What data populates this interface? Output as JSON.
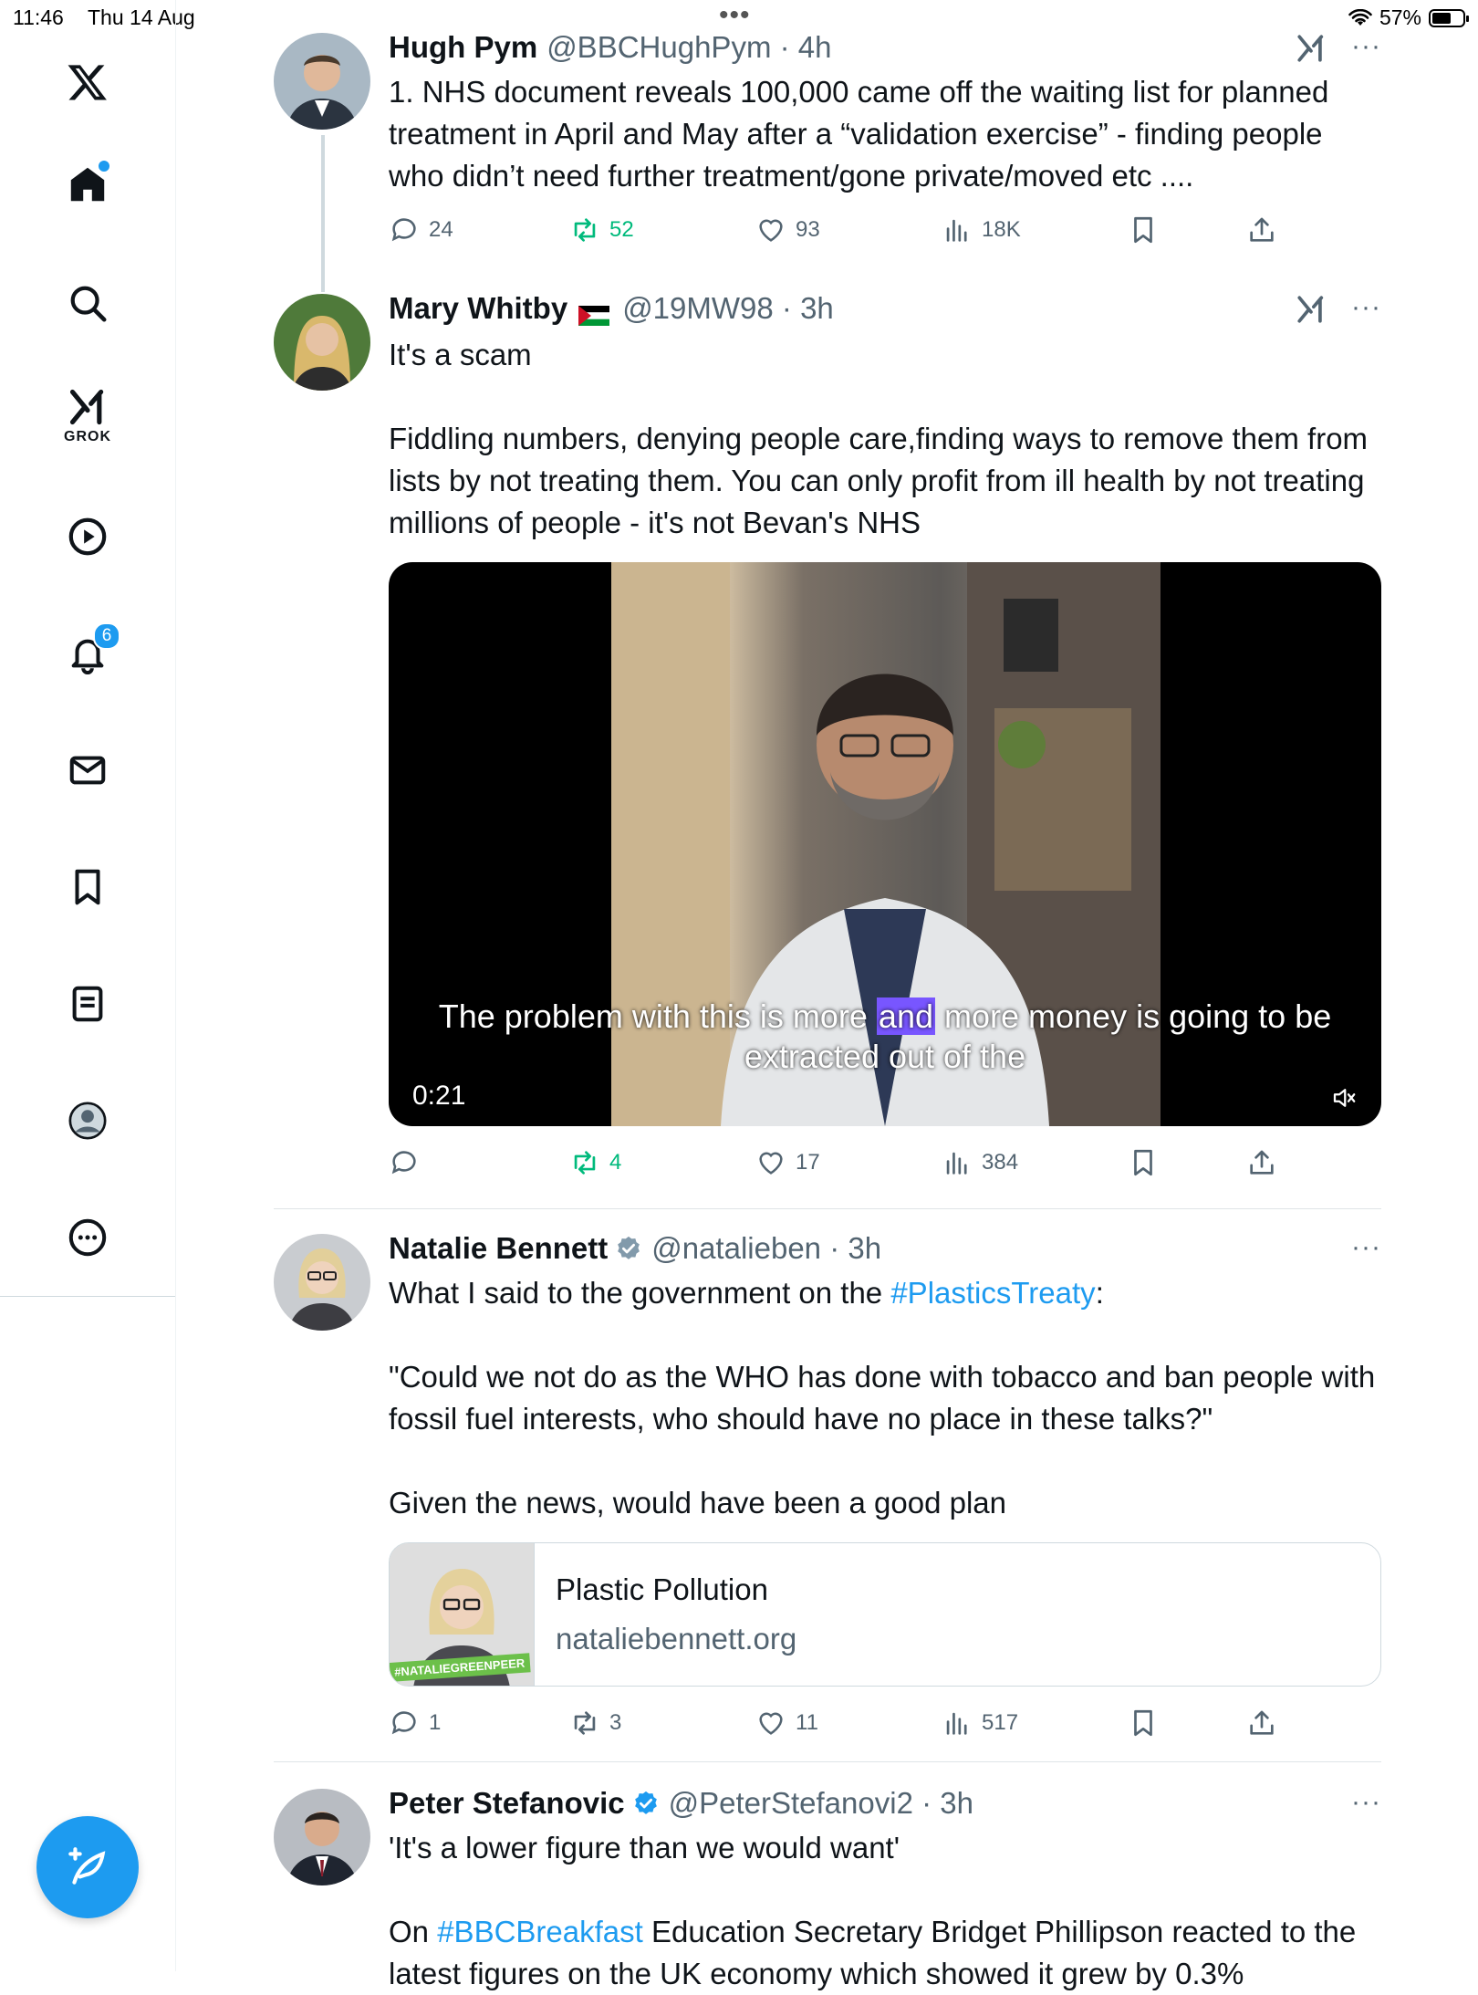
{
  "status_bar": {
    "time": "11:46",
    "date": "Thu 14 Aug",
    "battery": "57%"
  },
  "sidebar": {
    "grok_label": "GROK",
    "notifications_count": "6"
  },
  "colors": {
    "accent": "#1d9bf0",
    "retweet": "#00ba7c",
    "muted": "#536471",
    "caption_highlight": "#7856ff"
  },
  "tweets": [
    {
      "name": "Hugh Pym",
      "handle": "@BBCHughPym",
      "time": "4h",
      "text": "1. NHS document reveals 100,000 came off the waiting list for planned treatment in April and May after a “validation exercise” - finding people who didn’t need further treatment/gone private/moved etc ....",
      "replies": "24",
      "reposts": "52",
      "likes": "93",
      "views": "18K"
    },
    {
      "name": "Mary Whitby",
      "handle": "@19MW98",
      "time": "3h",
      "text": "It's a scam\n\nFiddling numbers, denying people care,finding ways to remove them from lists by not treating them. You can only profit from ill health by not treating millions of people - it's not Bevan's NHS",
      "video": {
        "caption_before": "The problem with this is more ",
        "caption_highlight": "and",
        "caption_after": " more money is going to be",
        "caption_line2": "extracted out of the",
        "duration": "0:21"
      },
      "replies": "",
      "reposts": "4",
      "likes": "17",
      "views": "384"
    },
    {
      "name": "Natalie Bennett",
      "handle": "@natalieben",
      "time": "3h",
      "text_before": "What I said to the government on the ",
      "hashtag": "#PlasticsTreaty",
      "text_after": ":\n\n\"Could we not do as the WHO has done with tobacco and ban people with fossil fuel interests, who should have no place in these talks?\"\n\nGiven the news, would have been a good plan",
      "card": {
        "title": "Plastic Pollution",
        "domain": "nataliebennett.org",
        "thumb_tag": "#NATALIEGREENPEER"
      },
      "replies": "1",
      "reposts": "3",
      "likes": "11",
      "views": "517"
    },
    {
      "name": "Peter Stefanovic",
      "handle": "@PeterStefanovi2",
      "time": "3h",
      "text_line1": "'It's a lower figure than we would want'",
      "text_before": "On ",
      "hashtag": "#BBCBreakfast",
      "text_after": " Education Secretary Bridget Phillipson reacted to the latest figures on the UK economy which showed it grew by 0.3%"
    }
  ]
}
